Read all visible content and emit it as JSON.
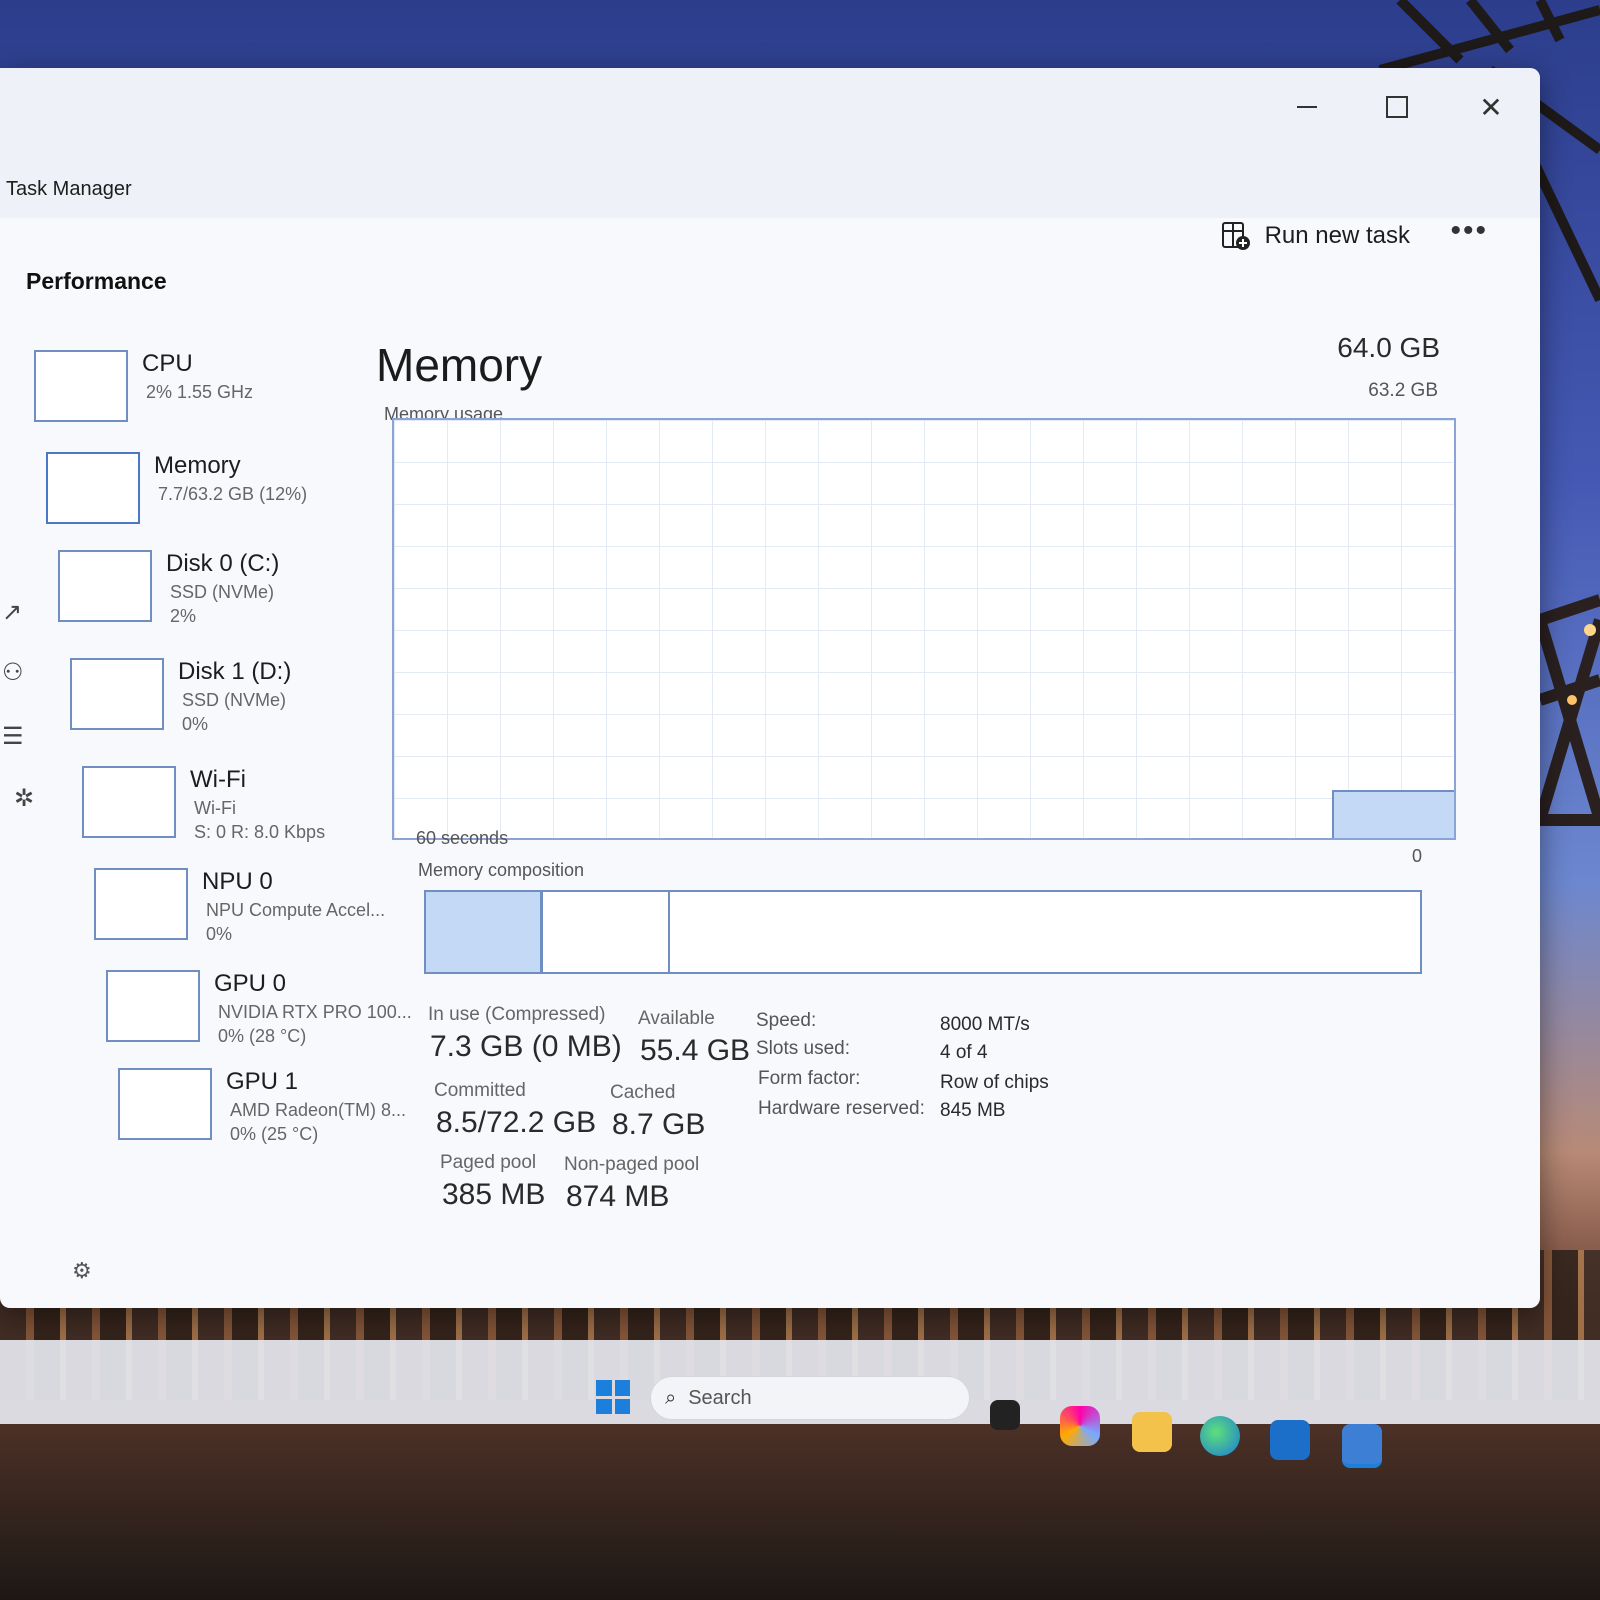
{
  "window": {
    "title": "Task Manager",
    "controls": {
      "minimize": "–",
      "maximize": "□",
      "close": "✕"
    }
  },
  "toolbar": {
    "run_new_task": "Run new task",
    "more": "•••"
  },
  "nav": {
    "section": "Performance"
  },
  "devices": [
    {
      "name": "CPU",
      "sub1": "2%  1.55 GHz",
      "sub2": ""
    },
    {
      "name": "Memory",
      "sub1": "7.7/63.2 GB (12%)",
      "sub2": ""
    },
    {
      "name": "Disk 0 (C:)",
      "sub1": "SSD (NVMe)",
      "sub2": "2%"
    },
    {
      "name": "Disk 1 (D:)",
      "sub1": "SSD (NVMe)",
      "sub2": "0%"
    },
    {
      "name": "Wi-Fi",
      "sub1": "Wi-Fi",
      "sub2": "S: 0 R: 8.0 Kbps"
    },
    {
      "name": "NPU 0",
      "sub1": "NPU Compute Accel...",
      "sub2": "0%"
    },
    {
      "name": "GPU 0",
      "sub1": "NVIDIA RTX PRO 100...",
      "sub2": "0% (28 °C)"
    },
    {
      "name": "GPU 1",
      "sub1": "AMD Radeon(TM) 8...",
      "sub2": "0% (25 °C)"
    }
  ],
  "memory": {
    "title": "Memory",
    "total": "64.0 GB",
    "max_usable": "63.2 GB",
    "usage_label": "Memory usage",
    "axis_left": "60 seconds",
    "axis_right": "0",
    "composition_label": "Memory composition",
    "usage_fraction": 0.12,
    "composition": {
      "in_use_fraction": 0.115,
      "modified_fraction": 0.125
    },
    "stats": {
      "in_use_label": "In use (Compressed)",
      "in_use_value": "7.3 GB (0 MB)",
      "available_label": "Available",
      "available_value": "55.4 GB",
      "committed_label": "Committed",
      "committed_value": "8.5/72.2 GB",
      "cached_label": "Cached",
      "cached_value": "8.7 GB",
      "paged_label": "Paged pool",
      "paged_value": "385 MB",
      "nonpaged_label": "Non-paged pool",
      "nonpaged_value": "874 MB"
    },
    "specs": {
      "speed_label": "Speed:",
      "speed_value": "8000 MT/s",
      "slots_label": "Slots used:",
      "slots_value": "4 of 4",
      "form_label": "Form factor:",
      "form_value": "Row of chips",
      "hw_label": "Hardware reserved:",
      "hw_value": "845 MB"
    }
  },
  "taskbar": {
    "search_placeholder": "Search"
  },
  "colors": {
    "accent": "#6f8fc3",
    "fill": "#c3d9f5",
    "start": "#1c7fdc"
  }
}
